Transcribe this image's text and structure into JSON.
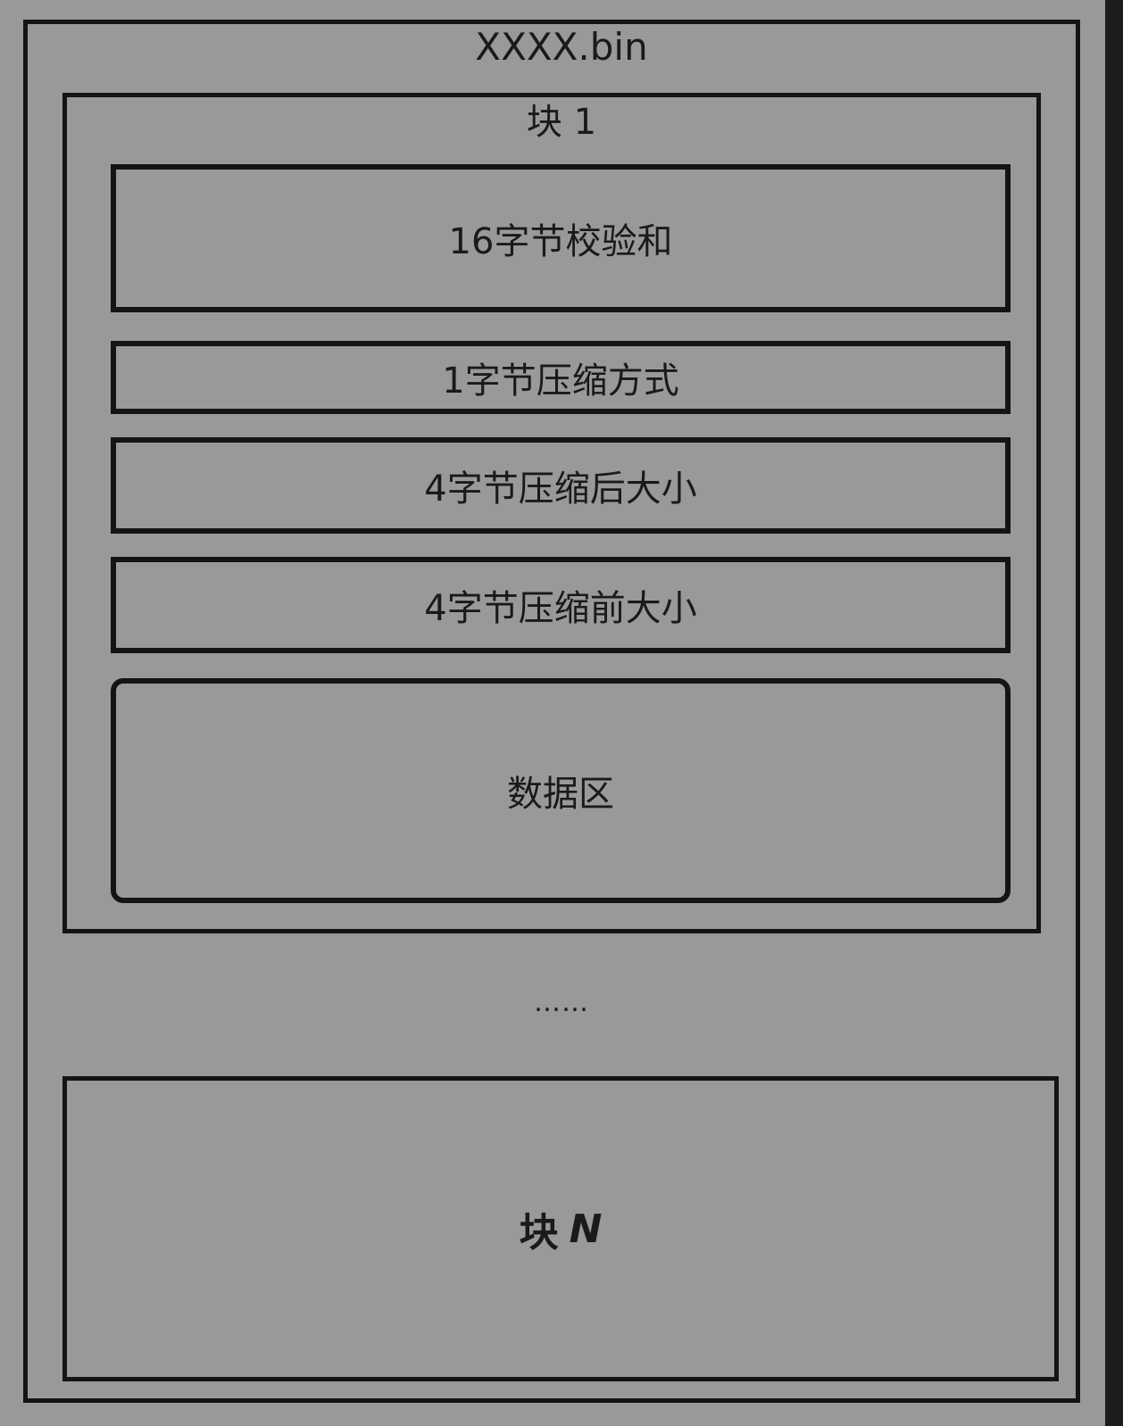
{
  "diagram": {
    "file_name": "XXXX.bin",
    "block_first": {
      "title": "块 1",
      "fields": [
        "16字节校验和",
        "1字节压缩方式",
        "4字节压缩后大小",
        "4字节压缩前大小",
        "数据区"
      ]
    },
    "ellipsis": "……",
    "block_last": {
      "prefix": "块",
      "letter": "N"
    }
  }
}
